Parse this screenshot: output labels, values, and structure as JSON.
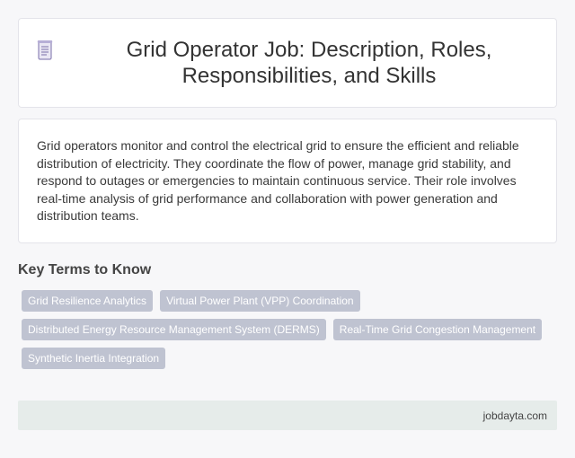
{
  "header": {
    "icon": "document-icon",
    "title": "Grid Operator Job: Description, Roles, Responsibilities, and Skills"
  },
  "description": {
    "text": "Grid operators monitor and control the electrical grid to ensure the efficient and reliable distribution of electricity. They coordinate the flow of power, manage grid stability, and respond to outages or emergencies to maintain continuous service. Their role involves real-time analysis of grid performance and collaboration with power generation and distribution teams."
  },
  "key_terms": {
    "heading": "Key Terms to Know",
    "items": [
      "Grid Resilience Analytics",
      "Virtual Power Plant (VPP) Coordination",
      "Distributed Energy Resource Management System (DERMS)",
      "Real-Time Grid Congestion Management",
      "Synthetic Inertia Integration"
    ]
  },
  "footer": {
    "site": "jobdayta.com"
  },
  "colors": {
    "background": "#f7f7f9",
    "card": "#ffffff",
    "chip": "#bfc3d1",
    "footer": "#e6ecea"
  }
}
